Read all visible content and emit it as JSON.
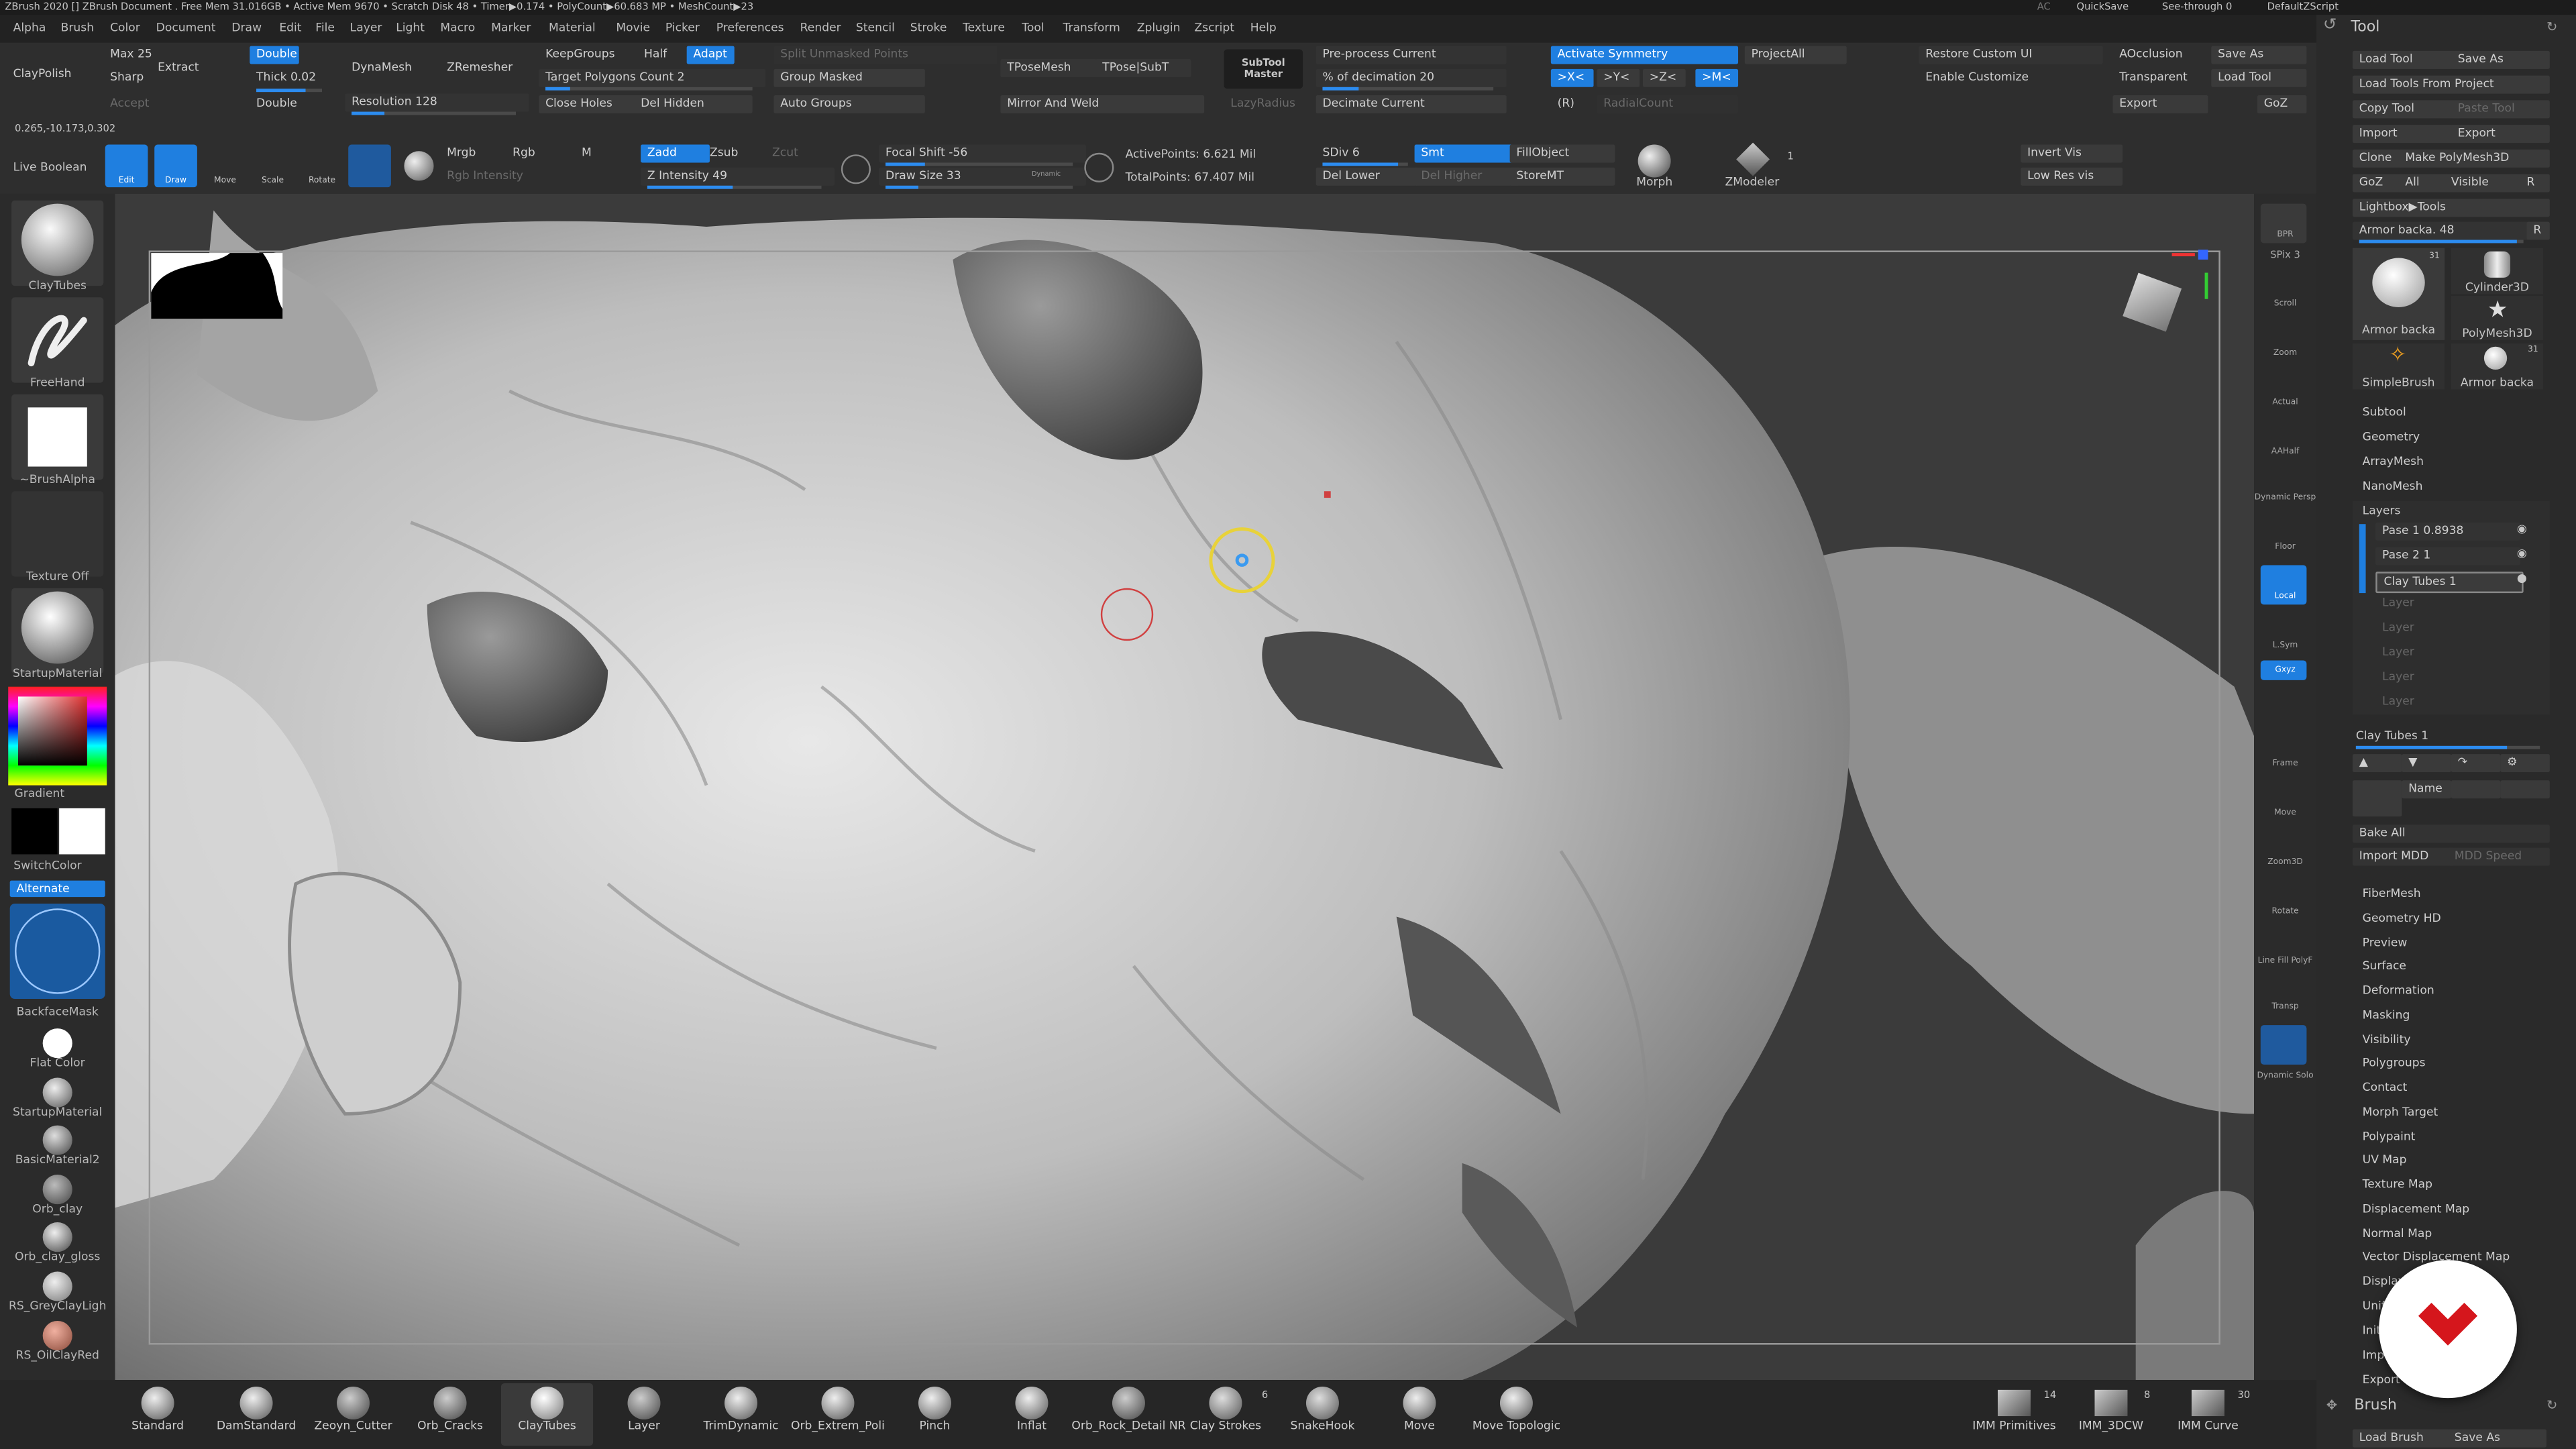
{
  "titlebar": {
    "text": "ZBrush 2020 []   ZBrush Document   . Free Mem 31.016GB • Active Mem 9670 • Scratch Disk 48 • Timer▶0.174 • PolyCount▶60.683 MP • MeshCount▶23",
    "ac": "AC",
    "quicksave": "QuickSave",
    "seethrough": "See-through  0",
    "script": "DefaultZScript"
  },
  "menu": [
    "Alpha",
    "Brush",
    "Color",
    "Document",
    "Draw",
    "Edit",
    "File",
    "Layer",
    "Light",
    "Macro",
    "Marker",
    "Material",
    "Movie",
    "Picker",
    "Preferences",
    "Render",
    "Stencil",
    "Stroke",
    "Texture",
    "Tool",
    "Transform",
    "Zplugin",
    "Zscript",
    "Help"
  ],
  "topshelf": {
    "claypolish": "ClayPolish",
    "max": "Max 25",
    "sharp": "Sharp",
    "accept": "Accept",
    "extract": "Extract",
    "double1": "Double",
    "thick": "Thick 0.02",
    "double2": "Double",
    "dynamesh": "DynaMesh",
    "zremesher": "ZRemesher",
    "resolution": "Resolution 128",
    "keepgroups": "KeepGroups",
    "half": "Half",
    "adapt": "Adapt",
    "target_polys": "Target Polygons Count 2",
    "closeholes": "Close Holes",
    "delhidden": "Del Hidden",
    "split_unmasked": "Split Unmasked Points",
    "group_masked": "Group Masked",
    "auto_groups": "Auto Groups",
    "tposemesh": "TPoseMesh",
    "tpose_subt": "TPose|SubT",
    "mirror_weld": "Mirror And Weld",
    "subtool_master": "SubTool Master",
    "lazyradius": "LazyRadius",
    "preprocess": "Pre-process Current",
    "decimation": "% of decimation 20",
    "decimate_current": "Decimate Current",
    "activate_symmetry": "Activate Symmetry",
    "projectall": "ProjectAll",
    "sym_x": ">X<",
    "sym_y": ">Y<",
    "sym_z": ">Z<",
    "sym_m": ">M<",
    "sym_r": "(R)",
    "radialcount": "RadialCount",
    "restore_ui": "Restore Custom UI",
    "enable_customize": "Enable Customize",
    "aocclusion": "AOcclusion",
    "transparent": "Transparent",
    "export": "Export",
    "saveas": "Save As",
    "loadtool": "Load Tool",
    "goz": "GoZ",
    "live_boolean": "Live Boolean",
    "edit": "Edit",
    "draw": "Draw",
    "move": "Move",
    "scale": "Scale",
    "rotate": "Rotate",
    "mrgb": "Mrgb",
    "rgb": "Rgb",
    "m": "M",
    "rgb_intensity": "Rgb Intensity",
    "zadd": "Zadd",
    "zsub": "Zsub",
    "zcut": "Zcut",
    "z_intensity": "Z Intensity 49",
    "focal_shift": "Focal Shift -56",
    "draw_size": "Draw Size 33",
    "dynamic": "Dynamic",
    "active_points": "ActivePoints: 6.621 Mil",
    "total_points": "TotalPoints: 67.407 Mil",
    "sdiv": "SDiv 6",
    "smt": "Smt",
    "del_lower": "Del Lower",
    "del_higher": "Del Higher",
    "fillobject": "FillObject",
    "storemt": "StoreMT",
    "morph": "Morph",
    "zmodeler": "ZModeler",
    "zmodeler_count": "1",
    "invert_vis": "Invert Vis",
    "low_res_vis": "Low Res vis",
    "coords": "0.265,-10.173,0.302"
  },
  "leftshelf": {
    "brush": "ClayTubes",
    "stroke": "FreeHand",
    "alpha": "~BrushAlpha",
    "texture": "Texture Off",
    "material": "StartupMaterial",
    "gradient": "Gradient",
    "switchcolor": "SwitchColor",
    "alternate": "Alternate",
    "backfacemask": "BackfaceMask",
    "flatcolor": "Flat Color",
    "materials": [
      "StartupMaterial",
      "BasicMaterial2",
      "Orb_clay",
      "Orb_clay_gloss",
      "RS_GreyClayLigh",
      "RS_OilClayRed"
    ]
  },
  "rightshelf": [
    "BPR",
    "SPix 3",
    "Scroll",
    "Zoom",
    "Actual",
    "AAHalf",
    "Dynamic Persp",
    "Floor",
    "Local",
    "L.Sym",
    "Gxyz",
    "Frame",
    "Move",
    "Zoom3D",
    "Rotate",
    "Line Fill PolyF",
    "Transp",
    "Dynamic Solo"
  ],
  "bottomshelf": {
    "brushes": [
      "Standard",
      "DamStandard",
      "Zeoyn_Cutter",
      "Orb_Cracks",
      "ClayTubes",
      "Layer",
      "TrimDynamic",
      "Orb_Extrem_Poli",
      "Pinch",
      "Inflat",
      "Orb_Rock_Detail NR",
      "Clay Strokes",
      "SnakeHook",
      "Move",
      "Move Topologic"
    ],
    "clay_strokes_count": "6",
    "imm": [
      {
        "label": "IMM Primitives",
        "count": "14"
      },
      {
        "label": "IMM_3DCW",
        "count": "8"
      },
      {
        "label": "IMM Curve",
        "count": "30"
      }
    ]
  },
  "toolpanel": {
    "title": "Tool",
    "load_tool": "Load Tool",
    "save_as": "Save As",
    "load_from_project": "Load Tools From Project",
    "copy_tool": "Copy Tool",
    "paste_tool": "Paste Tool",
    "import": "Import",
    "export": "Export",
    "clone": "Clone",
    "make_polymesh": "Make PolyMesh3D",
    "goz": "GoZ",
    "all": "All",
    "visible": "Visible",
    "r": "R",
    "lightbox_tools": "Lightbox▶Tools",
    "armor_slider": "Armor backa. 48",
    "thumbs": [
      {
        "label": "Armor backa",
        "count": "31"
      },
      {
        "label": "Cylinder3D",
        "count": ""
      },
      {
        "label": "PolyMesh3D",
        "count": ""
      },
      {
        "label": "SimpleBrush",
        "count": ""
      },
      {
        "label": "Armor backa",
        "count": "31"
      }
    ],
    "sections_top": [
      "Subtool",
      "Geometry",
      "ArrayMesh",
      "NanoMesh"
    ],
    "layers_title": "Layers",
    "layers": [
      {
        "name": "Pase 1 0.8938"
      },
      {
        "name": "Pase 2 1"
      },
      {
        "name": "Clay Tubes 1"
      }
    ],
    "empty_layers": [
      "Layer",
      "Layer",
      "Layer",
      "Layer",
      "Layer"
    ],
    "clay_tubes_slider": "Clay Tubes 1",
    "name_btn": "Name",
    "bake_all": "Bake All",
    "import_mdd": "Import MDD",
    "mdd_speed": "MDD Speed",
    "sections_bottom": [
      "FiberMesh",
      "Geometry HD",
      "Preview",
      "Surface",
      "Deformation",
      "Masking",
      "Visibility",
      "Polygroups",
      "Contact",
      "Morph Target",
      "Polypaint",
      "UV Map",
      "Texture Map",
      "Displacement Map",
      "Normal Map",
      "Vector Displacement Map",
      "Display Properties",
      "Unified Skin",
      "Initialize",
      "Import",
      "Export"
    ],
    "brush_header": "Brush",
    "load_brush": "Load Brush",
    "save_as_brush": "Save As"
  },
  "colors": {
    "accent": "#1f7fe0",
    "cursor_ring": "#e8d23a",
    "red_marker": "#d04040",
    "badge": "#d5161c"
  },
  "icons": [
    "undo-icon",
    "grid-icon",
    "gear-icon"
  ]
}
